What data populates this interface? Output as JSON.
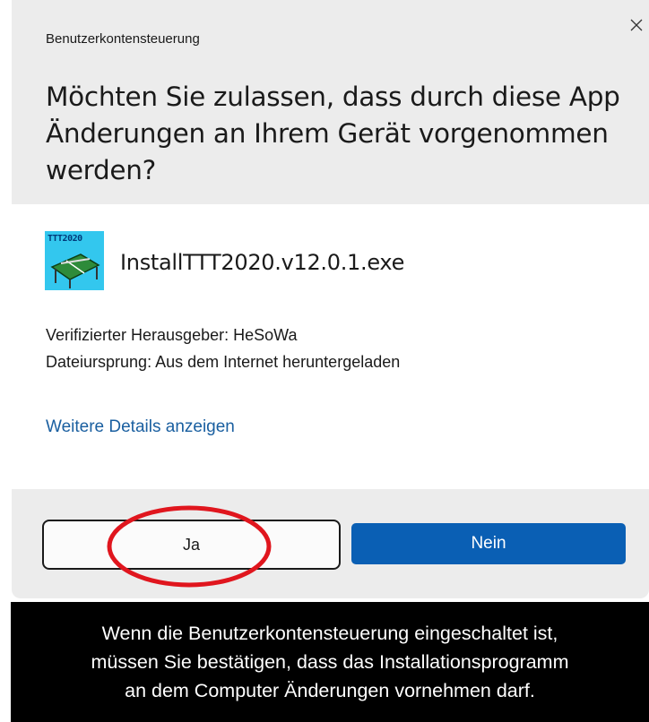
{
  "dialog": {
    "window_title": "Benutzerkontensteuerung",
    "question": "Möchten Sie zulassen, dass durch diese App Änderungen an Ihrem Gerät vorgenommen werden?",
    "app": {
      "icon": "ttt2020-app-icon",
      "icon_label": "TTT2020",
      "name": "InstallTTT2020.v12.0.1.exe"
    },
    "publisher_line": "Verifizierter Herausgeber: HeSoWa",
    "origin_line": "Dateiursprung: Aus dem Internet heruntergeladen",
    "details_link": "Weitere Details anzeigen",
    "buttons": {
      "yes": "Ja",
      "no": "Nein"
    },
    "colors": {
      "header_bg": "#ececec",
      "primary_button": "#0a5fb4",
      "link": "#1a5fa0",
      "highlight": "#e0161e"
    }
  },
  "caption": {
    "lines": [
      "Wenn die Benutzerkontensteuerung eingeschaltet ist,",
      "müssen Sie bestätigen, dass das Installationsprogramm",
      "an dem Computer Änderungen vornehmen darf."
    ]
  }
}
